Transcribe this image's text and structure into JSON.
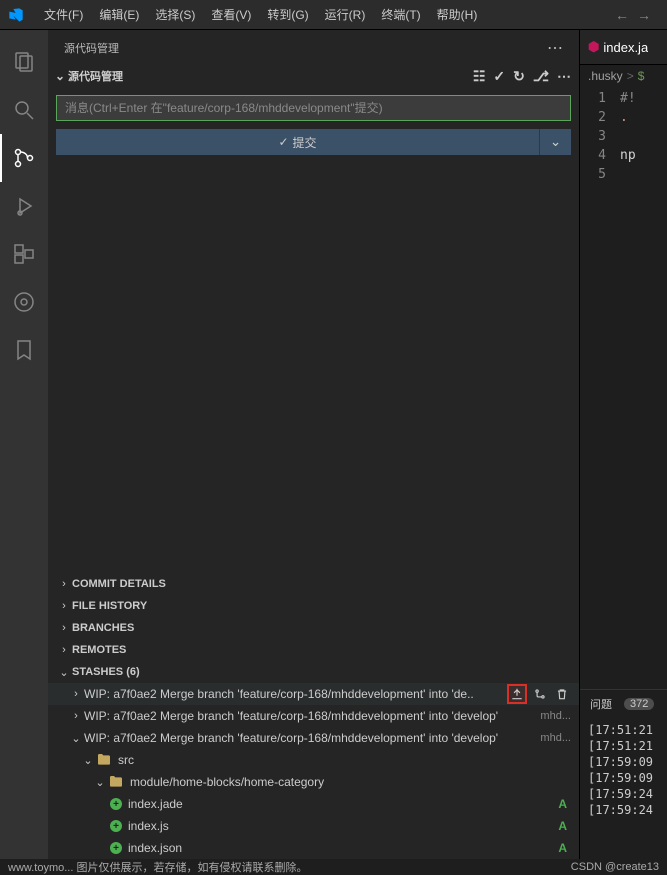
{
  "menu": {
    "items": [
      "文件(F)",
      "编辑(E)",
      "选择(S)",
      "查看(V)",
      "转到(G)",
      "运行(R)",
      "终端(T)",
      "帮助(H)"
    ]
  },
  "sidebar": {
    "title": "源代码管理",
    "scm_repo_title": "源代码管理",
    "commit_placeholder": "消息(Ctrl+Enter 在\"feature/corp-168/mhddevelopment\"提交)",
    "commit_button": "提交"
  },
  "sections": {
    "commit_details": "COMMIT DETAILS",
    "file_history": "FILE HISTORY",
    "branches": "BRANCHES",
    "remotes": "REMOTES",
    "stashes": "STASHES (6)"
  },
  "stashes": {
    "item1": "WIP: a7f0ae2 Merge branch 'feature/corp-168/mhddevelopment' into 'de..",
    "item2": "WIP: a7f0ae2 Merge branch 'feature/corp-168/mhddevelopment' into 'develop'",
    "item2_trail": "mhd...",
    "item3": "WIP: a7f0ae2 Merge branch 'feature/corp-168/mhddevelopment' into 'develop'",
    "item3_trail": "mhd...",
    "folder_src": "src",
    "folder_module": "module/home-blocks/home-category",
    "file1": "index.jade",
    "file2": "index.js",
    "file3": "index.json"
  },
  "status": {
    "A": "A"
  },
  "editor": {
    "tab": "index.ja",
    "breadcrumb1": ".husky",
    "breadcrumb_sep": ">",
    "line1": "#!",
    "line2": ".",
    "line4": "np"
  },
  "problems": {
    "label": "问题",
    "count": "372"
  },
  "terminal": {
    "l1": "[17:51:21",
    "l2": "[17:51:21",
    "l3": "[17:59:09",
    "l4": "[17:59:09",
    "l5": "[17:59:24",
    "l6": "[17:59:24"
  },
  "footer": {
    "left": "www.toymo... 图片仅供展示，若存储，如有侵权请联系删除。",
    "right": "CSDN @create13"
  }
}
